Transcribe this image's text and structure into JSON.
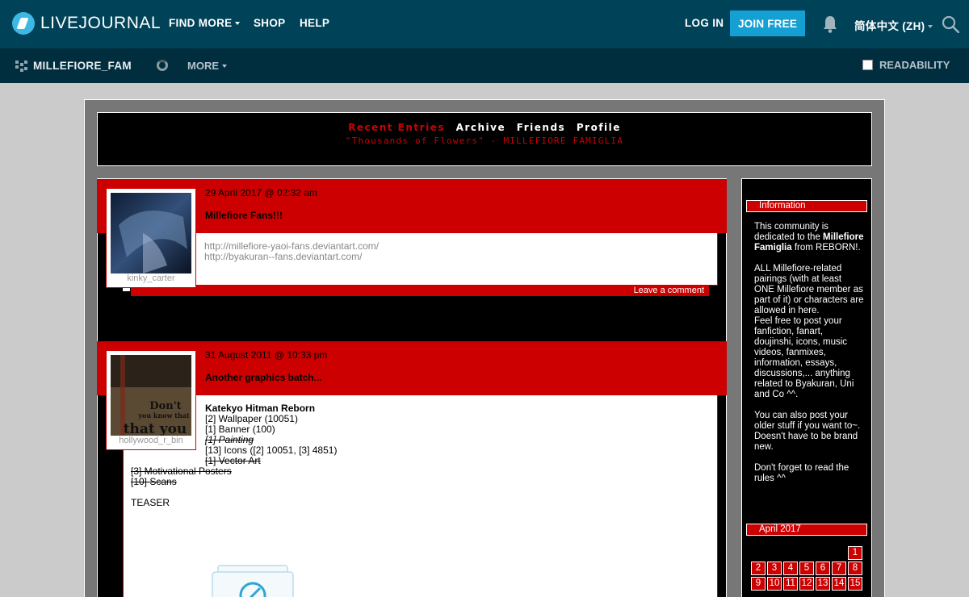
{
  "topbar": {
    "logo_text": "LIVEJOURNAL",
    "nav": [
      "FIND MORE",
      "SHOP",
      "HELP"
    ],
    "login_label": "LOG IN",
    "join_label": "JOIN FREE",
    "language_label": "简体中文 (ZH)"
  },
  "subbar": {
    "community_name": "MILLEFIORE_FAM",
    "more_label": "MORE",
    "readability_label": "READABILITY"
  },
  "header": {
    "nav": {
      "recent": "Recent Entries",
      "archive": "Archive",
      "friends": "Friends",
      "profile": "Profile"
    },
    "subtitle": "\"Thousands of Flowers\" - MILLEFIORE FAMIGLIA"
  },
  "entries": [
    {
      "user": "kinky_carter",
      "date": "29 April 2017 @ 02:32 am",
      "title": "Millefiore Fans!!!",
      "links": [
        "http://millefiore-yaoi-fans.deviantart.com/",
        "http://byakuran--fans.deviantart.com/"
      ],
      "comment_label": "Leave a comment"
    },
    {
      "user": "hollywood_r_bin",
      "date": "31 August 2011 @ 10:33 pm",
      "title": "Another graphics batch...",
      "heading": "Katekyo Hitman Reborn",
      "lines": [
        "[2] Wallpaper (10051)",
        "[1] Banner (100)",
        "[1] Painting",
        "[13] Icons ([2] 10051, [3] 4851)",
        "[1] Vector Art",
        "[3] Motivational Posters",
        "[10] Scans"
      ],
      "teaser": "TEASER",
      "avatar_text": [
        "Don't",
        "you know that",
        "that you"
      ]
    }
  ],
  "sidebar": {
    "info_heading": "Information",
    "info_pre": "This community is dedicated to the",
    "info_bold": "Millefiore Famiglia",
    "info_post": "from REBORN!.",
    "para2": "ALL Millefiore-related pairings (with at least ONE Millefiore member as part of it) or characters are allowed in here.",
    "para3": "Feel free to post your fanfiction, fanart, doujinshi, icons, music videos, fanmixes, information, essays, discussions,... anything related to Byakuran, Uni and Co ^^.",
    "para4": "You can also post your older stuff if you want to~. Doesn't have to be brand new.",
    "para5": "Don't forget to read the rules ^^",
    "calendar_heading": "April 2017",
    "calendar_days": [
      "1",
      "2",
      "3",
      "4",
      "5",
      "6",
      "7",
      "8",
      "9",
      "10",
      "11",
      "12",
      "13",
      "14",
      "15"
    ]
  },
  "colors": {
    "topbar": "#004359",
    "subbar": "#002e3e",
    "join_button": "#14a0d3",
    "theme_red": "#cc0000",
    "theme_black": "#000000"
  }
}
